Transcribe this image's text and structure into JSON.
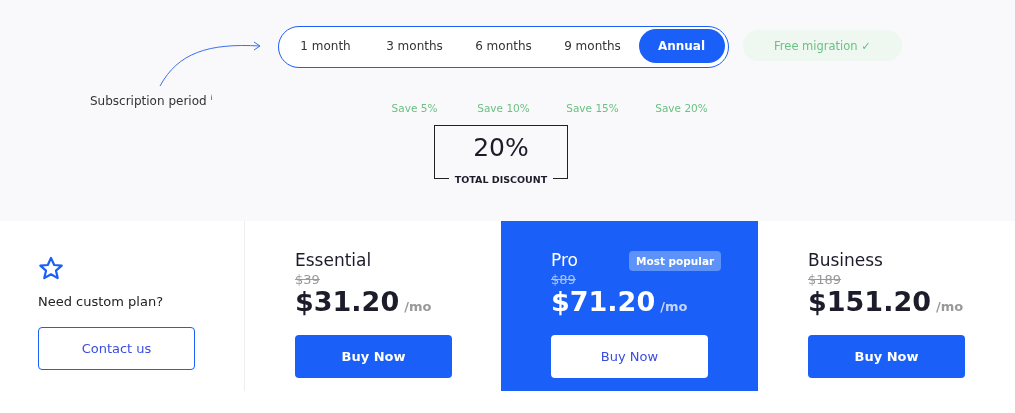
{
  "period_label": "Subscription period",
  "info_mark": "i",
  "periods": [
    {
      "label": "1 month",
      "selected": false
    },
    {
      "label": "3 months",
      "save": "Save 5%",
      "selected": false
    },
    {
      "label": "6 months",
      "save": "Save 10%",
      "selected": false
    },
    {
      "label": "9 months",
      "save": "Save 15%",
      "selected": false
    },
    {
      "label": "Annual",
      "save": "Save 20%",
      "selected": true
    }
  ],
  "migration": {
    "label": "Free migration",
    "check": "✓"
  },
  "discount": {
    "value": "20%",
    "label": "TOTAL DISCOUNT"
  },
  "plans": [
    {
      "kind": "custom",
      "text": "Need custom plan?",
      "button": "Contact us"
    },
    {
      "kind": "plan",
      "name": "Essential",
      "old_price": "$39",
      "price": "$31.20",
      "unit": "/mo",
      "button": "Buy Now",
      "featured": false
    },
    {
      "kind": "plan",
      "name": "Pro",
      "badge": "Most popular",
      "old_price": "$89",
      "price": "$71.20",
      "unit": "/mo",
      "button": "Buy Now",
      "featured": true
    },
    {
      "kind": "plan",
      "name": "Business",
      "old_price": "$189",
      "price": "$151.20",
      "unit": "/mo",
      "button": "Buy Now",
      "featured": false
    }
  ]
}
